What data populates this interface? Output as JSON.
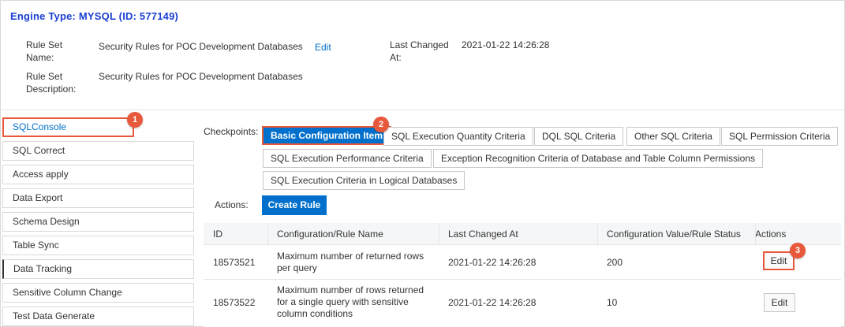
{
  "header": {
    "engine_title": "Engine Type: MYSQL (ID: 577149)"
  },
  "meta": {
    "rule_set_name_label_1": "Rule Set",
    "rule_set_name_label_2": "Name:",
    "rule_set_name_value": "Security Rules for POC Development Databases",
    "edit_link": "Edit",
    "last_changed_label_1": "Last Changed",
    "last_changed_label_2": "At:",
    "last_changed_value": "2021-01-22 14:26:28",
    "rule_set_desc_label_1": "Rule Set",
    "rule_set_desc_label_2": "Description:",
    "rule_set_desc_value": "Security Rules for POC Development Databases"
  },
  "sidebar": {
    "items": [
      {
        "label": "SQLConsole"
      },
      {
        "label": "SQL Correct"
      },
      {
        "label": "Access apply"
      },
      {
        "label": "Data Export"
      },
      {
        "label": "Schema Design"
      },
      {
        "label": "Table Sync"
      },
      {
        "label": "Data Tracking"
      },
      {
        "label": "Sensitive Column Change"
      },
      {
        "label": "Test Data Generate"
      }
    ]
  },
  "checkpoints": {
    "label": "Checkpoints:",
    "items": [
      {
        "label": "Basic Configuration Item"
      },
      {
        "label": "SQL Execution Quantity Criteria"
      },
      {
        "label": "DQL SQL Criteria"
      },
      {
        "label": "Other SQL Criteria"
      },
      {
        "label": "SQL Permission Criteria"
      },
      {
        "label": "SQL Execution Performance Criteria"
      },
      {
        "label": "Exception Recognition Criteria of Database and Table Column Permissions"
      },
      {
        "label": "SQL Execution Criteria in Logical Databases"
      }
    ]
  },
  "actions": {
    "label": "Actions:",
    "create_rule": "Create Rule"
  },
  "table": {
    "headers": [
      "ID",
      "Configuration/Rule Name",
      "Last Changed At",
      "Configuration Value/Rule Status",
      "Actions"
    ],
    "rows": [
      {
        "id": "18573521",
        "name_line1": "Maximum number of returned rows",
        "name_line2": "per query",
        "name_line3": "",
        "changed": "2021-01-22 14:26:28",
        "value": "200",
        "action": "Edit"
      },
      {
        "id": "18573522",
        "name_line1": "Maximum number of rows returned",
        "name_line2": "for a single query with sensitive",
        "name_line3": "column conditions",
        "changed": "2021-01-22 14:26:28",
        "value": "10",
        "action": "Edit"
      }
    ]
  },
  "callouts": [
    "1",
    "2",
    "3"
  ],
  "colors": {
    "primary": "#0070cc",
    "title": "#1a3fd1",
    "highlight": "#e8583a"
  }
}
